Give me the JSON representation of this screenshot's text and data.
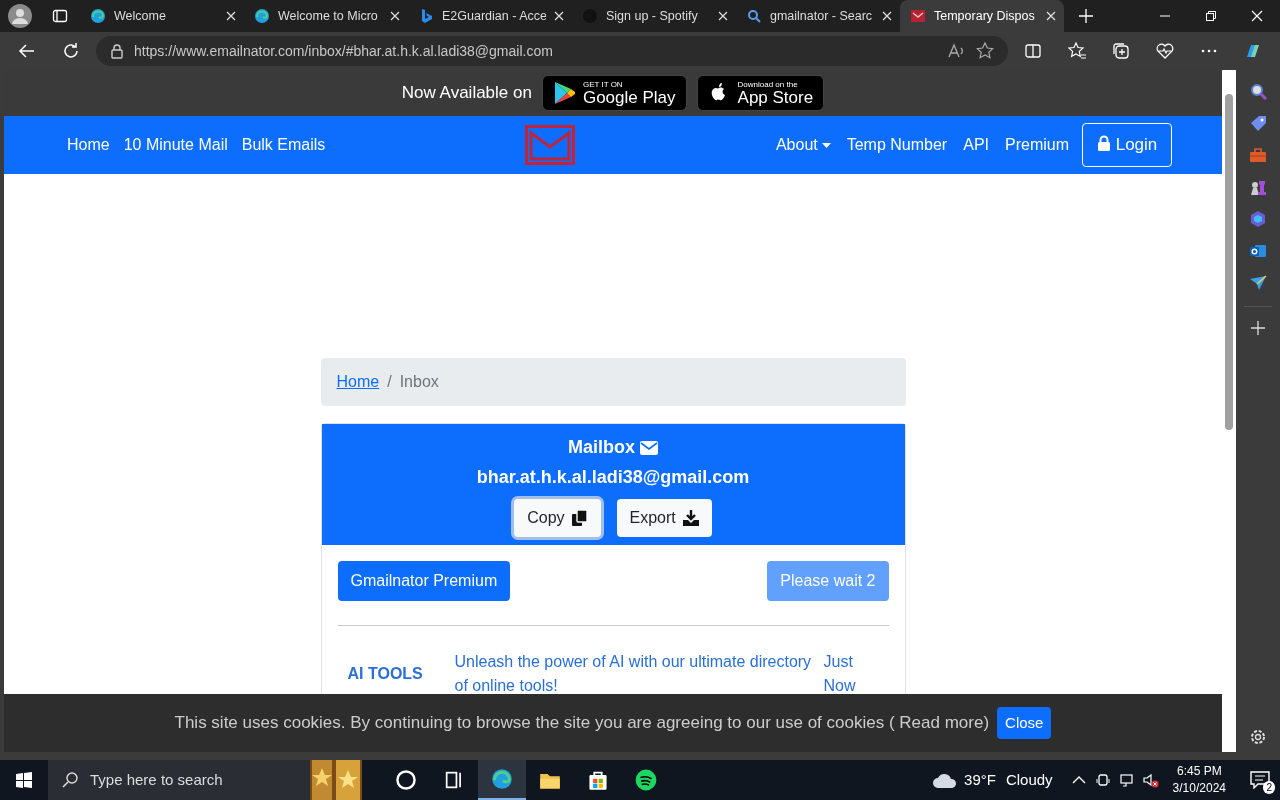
{
  "browser": {
    "tabs": [
      {
        "title": "Welcome",
        "selected": false
      },
      {
        "title": "Welcome to Micro",
        "selected": false
      },
      {
        "title": "E2Guardian - Acce",
        "selected": false
      },
      {
        "title": "Sign up - Spotify",
        "selected": false
      },
      {
        "title": "gmailnator - Searc",
        "selected": false
      },
      {
        "title": "Temporary Dispos",
        "selected": true
      }
    ],
    "address": "https://www.emailnator.com/inbox/#bhar.at.h.k.al.ladi38@gmail.com"
  },
  "app_banner": {
    "text": "Now Available on",
    "badges": [
      {
        "small": "GET IT ON",
        "large": "Google Play"
      },
      {
        "small": "Download on the",
        "large": "App Store"
      }
    ]
  },
  "navbar": {
    "left": [
      {
        "label": "Home"
      },
      {
        "label": "10 Minute Mail"
      },
      {
        "label": "Bulk Emails"
      }
    ],
    "right": [
      {
        "label": "About",
        "kind": "dropdown"
      },
      {
        "label": "Temp Number",
        "kind": "link"
      },
      {
        "label": "API",
        "kind": "link"
      },
      {
        "label": "Premium",
        "kind": "link"
      }
    ],
    "login": "Login"
  },
  "breadcrumb": {
    "separator": "/",
    "items": [
      {
        "label": "Home",
        "kind": "link"
      },
      {
        "label": "Inbox",
        "kind": "current"
      }
    ]
  },
  "mailbox": {
    "title": "Mailbox",
    "email": "bhar.at.h.k.al.ladi38@gmail.com",
    "buttons": [
      {
        "label": "Copy",
        "focused": true
      },
      {
        "label": "Export",
        "focused": false
      }
    ]
  },
  "actions": {
    "premium": "Gmailnator Premium",
    "wait": {
      "label": "Please wait 2",
      "disabled": true
    }
  },
  "messages": [
    {
      "from": "AI TOOLS",
      "subject": "Unleash the power of AI with our ultimate directory of online tools!",
      "time": "Just Now"
    }
  ],
  "cookie_bar": {
    "text": "This site uses cookies. By continuing to browse the site you are agreeing to our use of cookies ( ",
    "link": "Read more",
    "suffix": ")",
    "button": "Close"
  },
  "taskbar": {
    "search_placeholder": "Type here to search",
    "weather": {
      "temp": "39°F",
      "condition": "Cloudy"
    },
    "time": "6:45 PM",
    "date": "3/10/2024",
    "notifications": "2"
  }
}
